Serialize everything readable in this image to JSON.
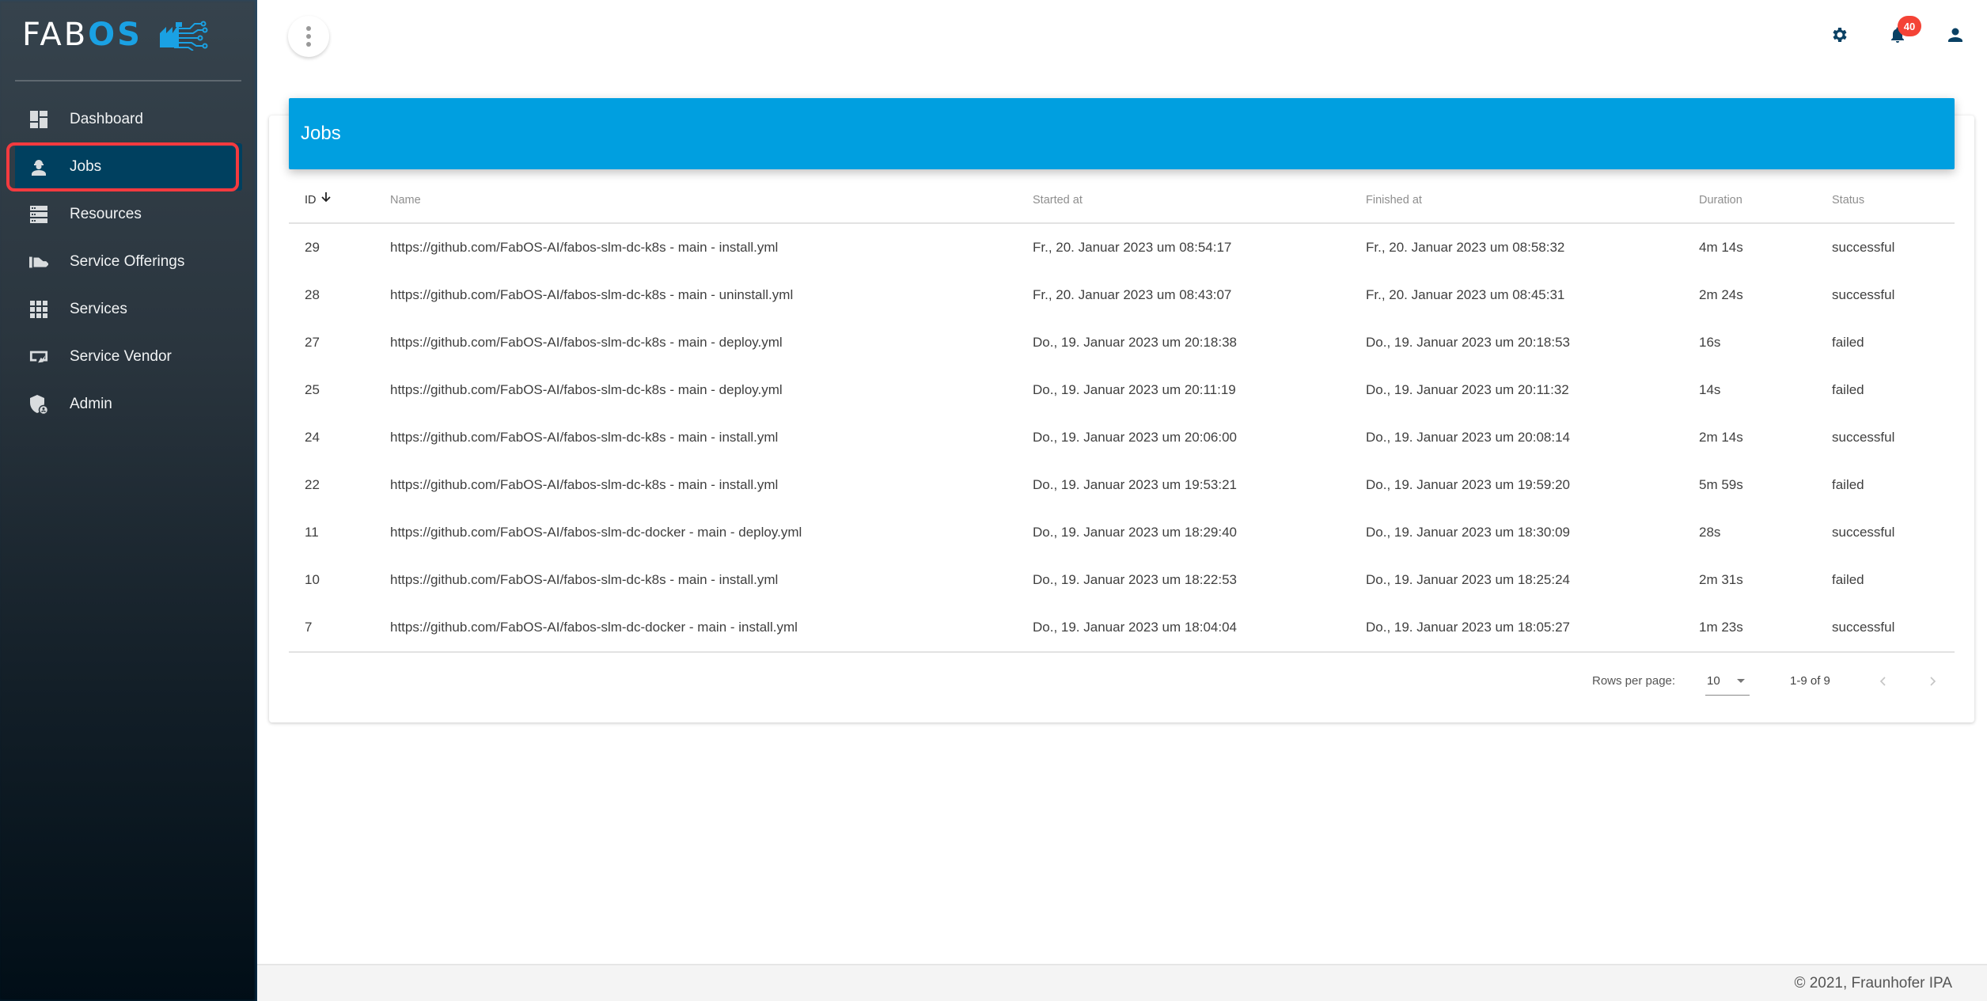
{
  "brand": {
    "name_part1": "FAB",
    "name_part2": "OS",
    "accent": "#009fe0",
    "logo_icon": "factory-circuit-icon"
  },
  "sidebar": {
    "items": [
      {
        "label": "Dashboard",
        "icon": "dashboard-icon",
        "active": false
      },
      {
        "label": "Jobs",
        "icon": "engineer-icon",
        "active": true
      },
      {
        "label": "Resources",
        "icon": "storage-icon",
        "active": false
      },
      {
        "label": "Service Offerings",
        "icon": "hand-offer-icon",
        "active": false
      },
      {
        "label": "Services",
        "icon": "apps-grid-icon",
        "active": false
      },
      {
        "label": "Service Vendor",
        "icon": "vendor-card-icon",
        "active": false
      },
      {
        "label": "Admin",
        "icon": "admin-shield-icon",
        "active": false
      }
    ]
  },
  "topbar": {
    "menu_icon": "more-vert-icon",
    "settings_icon": "gear-icon",
    "notifications_icon": "bell-icon",
    "notifications_count": "40",
    "account_icon": "person-icon"
  },
  "card": {
    "title": "Jobs"
  },
  "table": {
    "columns": {
      "id": "ID",
      "name": "Name",
      "started": "Started at",
      "finished": "Finished at",
      "duration": "Duration",
      "status": "Status"
    },
    "sort": {
      "column": "ID",
      "direction": "descending"
    },
    "rows": [
      {
        "id": "29",
        "name": "https://github.com/FabOS-AI/fabos-slm-dc-k8s - main - install.yml",
        "started": "Fr., 20. Januar 2023 um 08:54:17",
        "finished": "Fr., 20. Januar 2023 um 08:58:32",
        "duration": "4m 14s",
        "status": "successful"
      },
      {
        "id": "28",
        "name": "https://github.com/FabOS-AI/fabos-slm-dc-k8s - main - uninstall.yml",
        "started": "Fr., 20. Januar 2023 um 08:43:07",
        "finished": "Fr., 20. Januar 2023 um 08:45:31",
        "duration": "2m 24s",
        "status": "successful"
      },
      {
        "id": "27",
        "name": "https://github.com/FabOS-AI/fabos-slm-dc-k8s - main - deploy.yml",
        "started": "Do., 19. Januar 2023 um 20:18:38",
        "finished": "Do., 19. Januar 2023 um 20:18:53",
        "duration": "16s",
        "status": "failed"
      },
      {
        "id": "25",
        "name": "https://github.com/FabOS-AI/fabos-slm-dc-k8s - main - deploy.yml",
        "started": "Do., 19. Januar 2023 um 20:11:19",
        "finished": "Do., 19. Januar 2023 um 20:11:32",
        "duration": "14s",
        "status": "failed"
      },
      {
        "id": "24",
        "name": "https://github.com/FabOS-AI/fabos-slm-dc-k8s - main - install.yml",
        "started": "Do., 19. Januar 2023 um 20:06:00",
        "finished": "Do., 19. Januar 2023 um 20:08:14",
        "duration": "2m 14s",
        "status": "successful"
      },
      {
        "id": "22",
        "name": "https://github.com/FabOS-AI/fabos-slm-dc-k8s - main - install.yml",
        "started": "Do., 19. Januar 2023 um 19:53:21",
        "finished": "Do., 19. Januar 2023 um 19:59:20",
        "duration": "5m 59s",
        "status": "failed"
      },
      {
        "id": "11",
        "name": "https://github.com/FabOS-AI/fabos-slm-dc-docker - main - deploy.yml",
        "started": "Do., 19. Januar 2023 um 18:29:40",
        "finished": "Do., 19. Januar 2023 um 18:30:09",
        "duration": "28s",
        "status": "successful"
      },
      {
        "id": "10",
        "name": "https://github.com/FabOS-AI/fabos-slm-dc-k8s - main - install.yml",
        "started": "Do., 19. Januar 2023 um 18:22:53",
        "finished": "Do., 19. Januar 2023 um 18:25:24",
        "duration": "2m 31s",
        "status": "failed"
      },
      {
        "id": "7",
        "name": "https://github.com/FabOS-AI/fabos-slm-dc-docker - main - install.yml",
        "started": "Do., 19. Januar 2023 um 18:04:04",
        "finished": "Do., 19. Januar 2023 um 18:05:27",
        "duration": "1m 23s",
        "status": "successful"
      }
    ]
  },
  "pagination": {
    "rows_per_page_label": "Rows per page:",
    "rows_per_page_value": "10",
    "range": "1-9 of 9",
    "prev_icon": "chevron-left-icon",
    "next_icon": "chevron-right-icon"
  },
  "footer": {
    "text": "© 2021, Fraunhofer IPA"
  }
}
